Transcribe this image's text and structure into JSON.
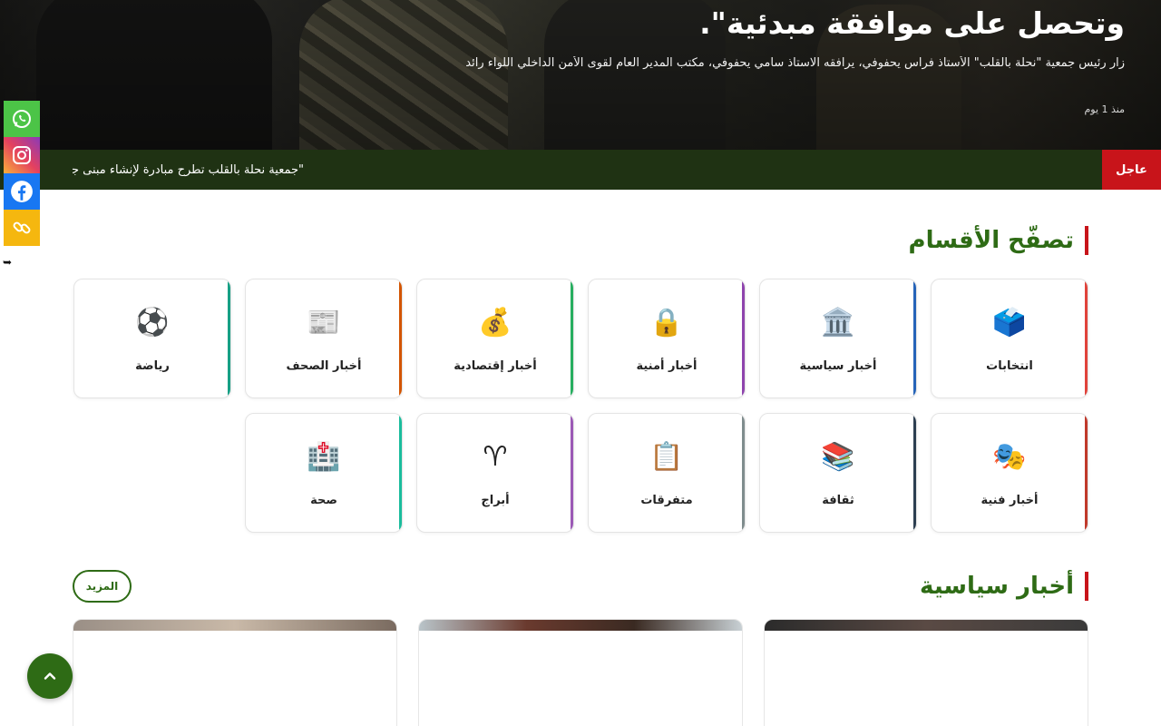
{
  "hero": {
    "title": "وتحصل على موافقة مبدئية\".",
    "excerpt": "زار رئيس جمعية \"نحلة بالقلب\" الأستاذ فراس يحفوفي، يرافقه الاستاذ سامي يحفوفي، مكتب المدير العام لقوى الأمن الداخلي اللواء رائد",
    "time": "منذ 1 يوم"
  },
  "breaking": {
    "label": "عاجل",
    "text": "\"جمعية نحلة بالقلب تطرح مبادرة لإنشاء مبنى جديد لل"
  },
  "social": {
    "items": [
      "whatsapp-icon",
      "instagram-icon",
      "facebook-icon",
      "copy-link-icon"
    ]
  },
  "categories": {
    "title": "تصفّح الأقسام",
    "items": [
      {
        "label": "انتخابات",
        "icon": "🗳️",
        "color": "#e0433b"
      },
      {
        "label": "أخبار سياسية",
        "icon": "🏛️",
        "color": "#2563b8"
      },
      {
        "label": "أخبار أمنية",
        "icon": "🔒",
        "color": "#8e44ad"
      },
      {
        "label": "أخبار إقتصادية",
        "icon": "💰",
        "color": "#27ae60"
      },
      {
        "label": "أخبار الصحف",
        "icon": "📰",
        "color": "#d35400"
      },
      {
        "label": "رياضة",
        "icon": "⚽",
        "color": "#16a085"
      },
      {
        "label": "أخبار فنية",
        "icon": "🎭",
        "color": "#c0392b"
      },
      {
        "label": "ثقافة",
        "icon": "📚",
        "color": "#2c3e50"
      },
      {
        "label": "متفرقات",
        "icon": "📋",
        "color": "#7f8c8d"
      },
      {
        "label": "أبراج",
        "icon": "♈",
        "color": "#9b59b6"
      },
      {
        "label": "صحة",
        "icon": "🏥",
        "color": "#1abc9c"
      }
    ]
  },
  "politics": {
    "title": "أخبار سياسية",
    "more_label": "المزيد"
  }
}
